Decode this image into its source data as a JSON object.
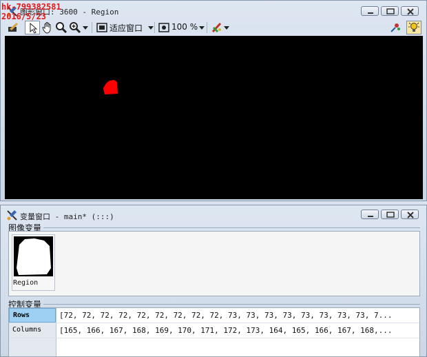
{
  "graphics_window": {
    "title": "图形窗口: 3600 - Region",
    "toolbar": {
      "fit_label": "适应窗口",
      "zoom_label": "100 %"
    }
  },
  "watermark": {
    "line1": "hk-799382581",
    "line2": "2016/5/23"
  },
  "variable_window": {
    "title": "变量窗口 - main* (:::)",
    "image_vars_label": "图像变量",
    "image_vars": [
      {
        "name": "Region"
      }
    ],
    "control_vars_label": "控制变量",
    "control_vars": [
      {
        "name": "Rows",
        "value": "[72, 72, 72, 72, 72, 72, 72, 72, 72, 73, 73, 73, 73, 73, 73, 73, 73, 7..."
      },
      {
        "name": "Columns",
        "value": "[165, 166, 167, 168, 169, 170, 171, 172, 173, 164, 165, 166, 167, 168,..."
      }
    ]
  },
  "colors": {
    "region": "#ff0000",
    "canvas": "#000000",
    "selected_row": "#9dd0f2"
  }
}
